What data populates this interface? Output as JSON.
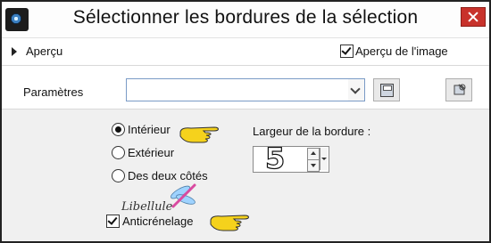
{
  "window": {
    "title": "Sélectionner les bordures de la sélection",
    "close_icon": "close-icon"
  },
  "preview": {
    "label": "Aperçu",
    "image_preview_label": "Aperçu de l'image",
    "image_preview_checked": true
  },
  "params": {
    "label": "Paramètres",
    "preset_value": "",
    "save_icon": "save-icon",
    "reset_icon": "reset-icon"
  },
  "options": {
    "inside_label": "Intérieur",
    "outside_label": "Extérieur",
    "both_label": "Des deux côtés",
    "selected": "Intérieur"
  },
  "border_width": {
    "label": "Largeur de la bordure :",
    "value": "5"
  },
  "antialias": {
    "label": "Anticrénelage",
    "checked": true
  },
  "watermark": {
    "text": "Libellule"
  },
  "colors": {
    "close_button": "#c8322b",
    "pointer_yellow": "#f5d21c",
    "combo_border": "#7a9bc6"
  }
}
